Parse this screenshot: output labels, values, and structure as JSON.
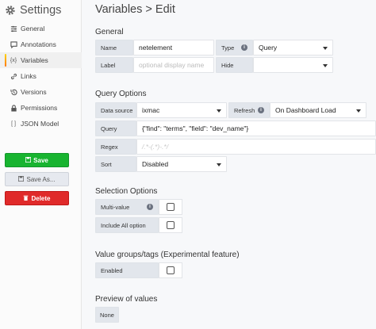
{
  "sidebar": {
    "title": "Settings",
    "items": [
      {
        "label": "General",
        "icon": "sliders-icon",
        "active": false
      },
      {
        "label": "Annotations",
        "icon": "comment-icon",
        "active": false
      },
      {
        "label": "Variables",
        "icon": "variable-icon",
        "active": true
      },
      {
        "label": "Links",
        "icon": "link-icon",
        "active": false
      },
      {
        "label": "Versions",
        "icon": "history-icon",
        "active": false
      },
      {
        "label": "Permissions",
        "icon": "lock-icon",
        "active": false
      },
      {
        "label": "JSON Model",
        "icon": "code-icon",
        "active": false
      }
    ],
    "save_label": "Save",
    "save_as_label": "Save As...",
    "delete_label": "Delete"
  },
  "main": {
    "title": "Variables > Edit",
    "general": {
      "heading": "General",
      "name_label": "Name",
      "name_value": "netelement",
      "type_label": "Type",
      "type_value": "Query",
      "label_label": "Label",
      "label_placeholder": "optional display name",
      "hide_label": "Hide",
      "hide_value": ""
    },
    "query_options": {
      "heading": "Query Options",
      "datasource_label": "Data source",
      "datasource_value": "ixmac",
      "refresh_label": "Refresh",
      "refresh_value": "On Dashboard Load",
      "query_label": "Query",
      "query_value": "{\"find\": \"terms\", \"field\": \"dev_name\"}",
      "regex_label": "Regex",
      "regex_placeholder": "/.*-(.*)-.*/",
      "sort_label": "Sort",
      "sort_value": "Disabled"
    },
    "selection_options": {
      "heading": "Selection Options",
      "multi_value_label": "Multi-value",
      "include_all_label": "Include All option"
    },
    "value_groups": {
      "heading": "Value groups/tags (Experimental feature)",
      "enabled_label": "Enabled"
    },
    "preview": {
      "heading": "Preview of values",
      "value": "None"
    }
  }
}
